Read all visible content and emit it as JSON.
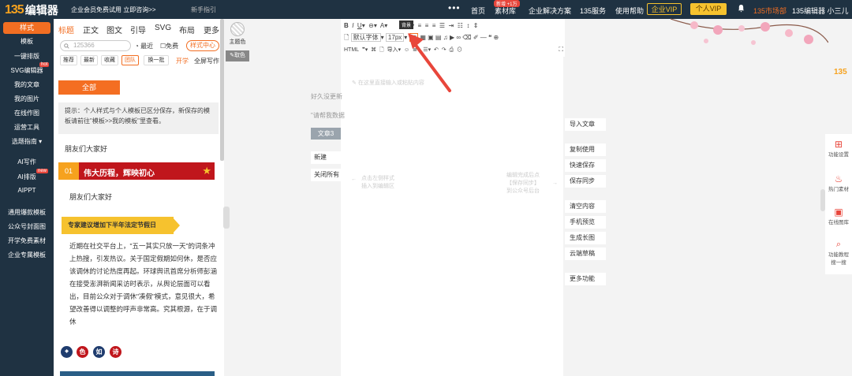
{
  "topbar": {
    "logo_mark": "135",
    "logo_text": "编辑器",
    "promo": "企业会员免费试用 立即咨询>>",
    "novice": "新手指引",
    "nav": [
      "首页",
      "素材库",
      "企业解决方案",
      "135服务",
      "使用帮助"
    ],
    "nav_badge": "新增 +1万",
    "enterprise_vip": "企业VIP",
    "personal_vip": "个人VIP",
    "market": "135市场部",
    "user": "135编辑器 小三儿"
  },
  "sidebar": {
    "items": [
      "样式",
      "模板",
      "一键排版",
      "SVG编辑器",
      "我的文章",
      "我的图片",
      "在线作图",
      "运营工具",
      "选题指南",
      "AI写作",
      "AI排版",
      "AIPPT",
      "通用爆款模板",
      "公众号封面图",
      "开学免费素材",
      "企业专属模板"
    ],
    "hot_label": "hot",
    "new_label": "new"
  },
  "panel": {
    "tabs": [
      "标题",
      "正文",
      "图文",
      "引导",
      "SVG",
      "布局",
      "更多"
    ],
    "search_placeholder": "125366",
    "recent": "最近",
    "free": "免费",
    "style_center": "样式中心",
    "chips": [
      "推荐",
      "最新",
      "收藏",
      "团队",
      "换一批"
    ],
    "kaixue": "开学",
    "full_screen": "全屏写作",
    "all_button": "全部",
    "tip": "提示：个人样式与个人模板已区分保存，新保存的模板请前往\"模板>>我的模板\"里查看。",
    "greeting1": "朋友们大家好",
    "ribbon_num": "01",
    "ribbon_text": "伟大历程，辉映初心",
    "greeting2": "朋友们大家好",
    "yellow_tag": "专家建议增加下半年法定节假日",
    "article": "近期在社交平台上，\"五一其实只放一天\"的词条冲上热搜，引发热议。关于国定假期如何休，是否应该调休的讨论热度再起。环球舆讯首席分析师彭涵在接受澎湃新闻采访时表示，从舆论层面可以看出，目前公众对于调休\"凑假\"模式，意见很大，希望改善得以调整的呼声非常高。究其根源，在于调休",
    "circles": [
      "色",
      "如",
      "诗"
    ]
  },
  "rcol": {
    "theme_color": "主题色",
    "reset_color": "取色"
  },
  "editor": {
    "font_name": "默认字体",
    "font_size": "17px",
    "html_label": "HTML",
    "import_label": "导入",
    "tooltip": "背景",
    "placeholder": "在这里直接输入或粘贴内容",
    "left_hint1": "点击左侧样式",
    "left_hint2": "插入到编辑区",
    "right_hint1": "编辑完成后点",
    "right_hint2": "【保存同步】",
    "right_hint3": "到公众号后台",
    "ghost1": "好久没更新",
    "ghost2": "\"请帮我数据",
    "article3": "文章3",
    "new_btn": "新建",
    "close_all": "关闭所有"
  },
  "side_actions": [
    "导入文章",
    "复制使用",
    "快速保存",
    "保存同步",
    "清空内容",
    "手机预览",
    "生成长图",
    "云端草稿",
    "更多功能"
  ],
  "right_tools": [
    "功能设置",
    "热门素材",
    "在线图库",
    "功能教程 搜一搜"
  ],
  "colors": {
    "dark": "#1f3242",
    "orange": "#f26e22",
    "red": "#c0161c",
    "gold": "#f6c22e"
  }
}
